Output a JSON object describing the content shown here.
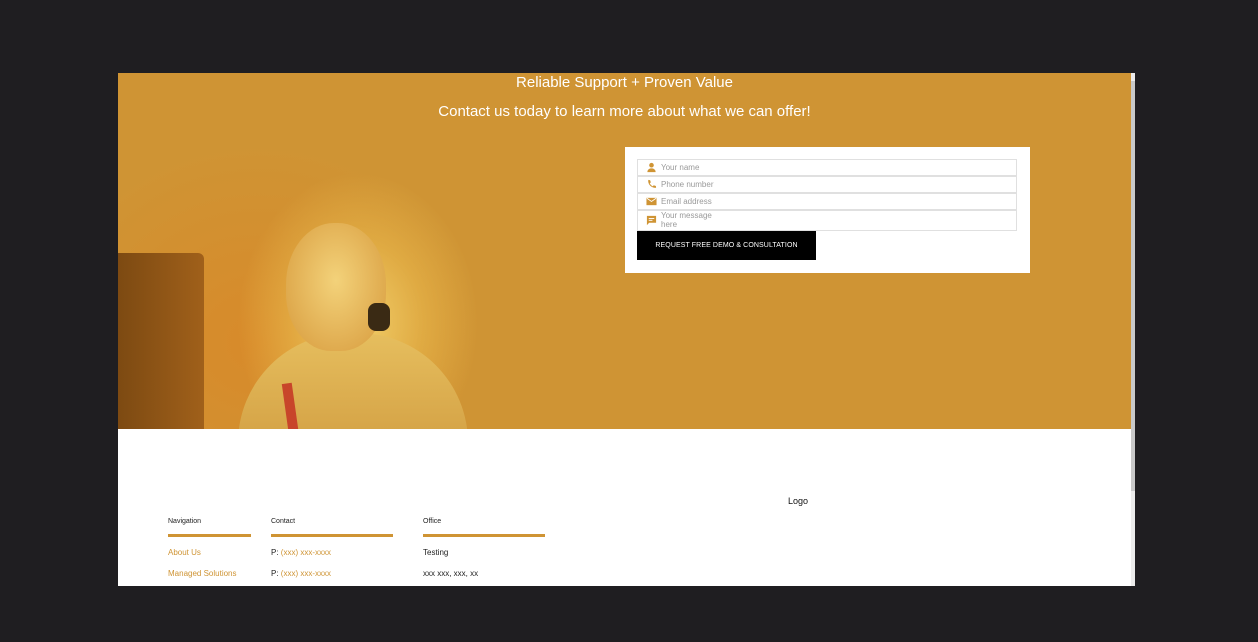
{
  "hero": {
    "title": "Reliable Support + Proven Value",
    "subtitle": "Contact us today to learn more about what we can offer!"
  },
  "form": {
    "name_placeholder": "Your name",
    "phone_placeholder": "Phone number",
    "email_placeholder": "Email address",
    "message_placeholder": "Your message here",
    "submit_label": "REQUEST FREE DEMO & CONSULTATION"
  },
  "footer": {
    "logo": "Logo",
    "navigation": {
      "heading": "Navigation",
      "links": [
        "About Us",
        "Managed Solutions"
      ]
    },
    "contact": {
      "heading": "Contact",
      "prefix": "P:",
      "phones": [
        "(xxx) xxx-xxxx",
        "(xxx) xxx-xxxx"
      ]
    },
    "office": {
      "heading": "Office",
      "lines": [
        "Testing",
        "xxx xxx, xxx, xx"
      ]
    }
  },
  "colors": {
    "accent": "#cf9434",
    "page_background": "#1f1e21",
    "button": "#000000"
  },
  "icons": [
    "person-icon",
    "phone-icon",
    "mail-icon",
    "message-icon"
  ]
}
